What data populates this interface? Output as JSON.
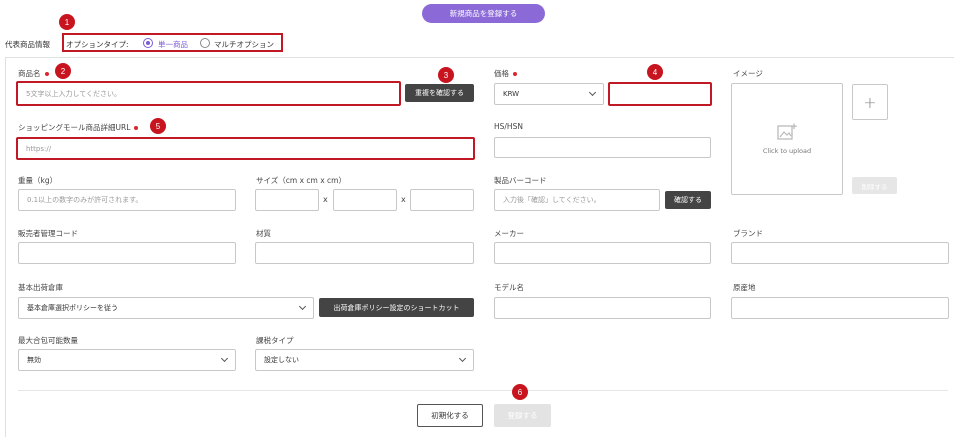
{
  "header": {
    "register_button": "新規商品を登録する"
  },
  "option_type": {
    "section_label": "代表商品情報",
    "label": "オプションタイプ:",
    "options": [
      "単一商品",
      "マルチオプション"
    ],
    "selected": "単一商品"
  },
  "product_name": {
    "label": "商品名",
    "placeholder": "5文字以上入力してください。",
    "check_button": "重複を確認する"
  },
  "price": {
    "label": "価格",
    "currency": "KRW",
    "value": ""
  },
  "image": {
    "label": "イメージ",
    "upload_text": "Click to upload",
    "add_symbol": "+",
    "delete_button": "削除する"
  },
  "shopping_url": {
    "label": "ショッピングモール商品詳細URL",
    "placeholder": "https://"
  },
  "hs_hsn": {
    "label": "HS/HSN",
    "value": ""
  },
  "weight": {
    "label": "重量（kg）",
    "placeholder": "0.1以上の数字のみが許可されます。"
  },
  "size": {
    "label": "サイズ（cm x cm x cm）",
    "separator": "x"
  },
  "barcode": {
    "label": "製品バーコード",
    "placeholder": "入力後「確認」してください。",
    "confirm_button": "確認する"
  },
  "seller_code": {
    "label": "販売者管理コード"
  },
  "material": {
    "label": "材質"
  },
  "maker": {
    "label": "メーカー"
  },
  "brand": {
    "label": "ブランド"
  },
  "warehouse": {
    "label": "基本出荷倉庫",
    "value": "基本倉庫選択ポリシーを従う",
    "shortcut_button": "出荷倉庫ポリシー設定のショートカット"
  },
  "model": {
    "label": "モデル名"
  },
  "origin": {
    "label": "原産地"
  },
  "max_qty": {
    "label": "最大合包可能数量",
    "value": "無効"
  },
  "tax_type": {
    "label": "課税タイプ",
    "value": "設定しない"
  },
  "footer": {
    "reset_button": "初期化する",
    "submit_button": "登録する"
  },
  "markers": [
    "1",
    "2",
    "3",
    "4",
    "5",
    "6"
  ],
  "colors": {
    "accent": "#8b6ad8",
    "highlight": "#c01824",
    "marker": "#c8141e"
  }
}
